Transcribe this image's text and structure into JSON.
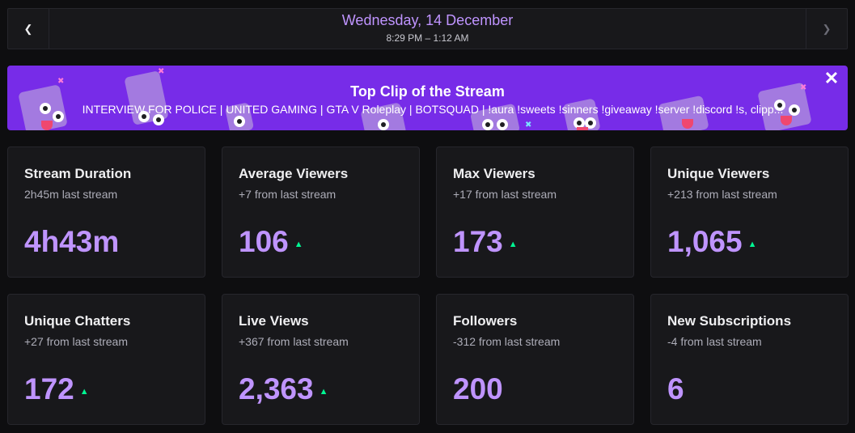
{
  "date_nav": {
    "title": "Wednesday, 14 December",
    "time_range": "8:29 PM – 1:12 AM",
    "prev_icon": "chevron-left-icon",
    "next_icon": "chevron-right-icon"
  },
  "banner": {
    "title": "Top Clip of the Stream",
    "clip_title": "INTERVIEW FOR POLICE | UNITED GAMING | GTA V Roleplay | BOTSQUAD | !aura !sweets !sinners !giveaway !server !discord !s, clipp...",
    "close_icon": "close-icon",
    "background_color": "#772ce8"
  },
  "colors": {
    "accent": "#bf94ff",
    "up_trend": "#00f593",
    "card_bg": "#18181b",
    "page_bg": "#0e0e10"
  },
  "stats": [
    {
      "title": "Stream Duration",
      "sub": "2h45m last stream",
      "value": "4h43m",
      "trend": "none"
    },
    {
      "title": "Average Viewers",
      "sub": "+7 from last stream",
      "value": "106",
      "trend": "up"
    },
    {
      "title": "Max Viewers",
      "sub": "+17 from last stream",
      "value": "173",
      "trend": "up"
    },
    {
      "title": "Unique Viewers",
      "sub": "+213 from last stream",
      "value": "1,065",
      "trend": "up"
    },
    {
      "title": "Unique Chatters",
      "sub": "+27 from last stream",
      "value": "172",
      "trend": "up"
    },
    {
      "title": "Live Views",
      "sub": "+367 from last stream",
      "value": "2,363",
      "trend": "up"
    },
    {
      "title": "Followers",
      "sub": "-312 from last stream",
      "value": "200",
      "trend": "none"
    },
    {
      "title": "New Subscriptions",
      "sub": "-4 from last stream",
      "value": "6",
      "trend": "none"
    }
  ]
}
